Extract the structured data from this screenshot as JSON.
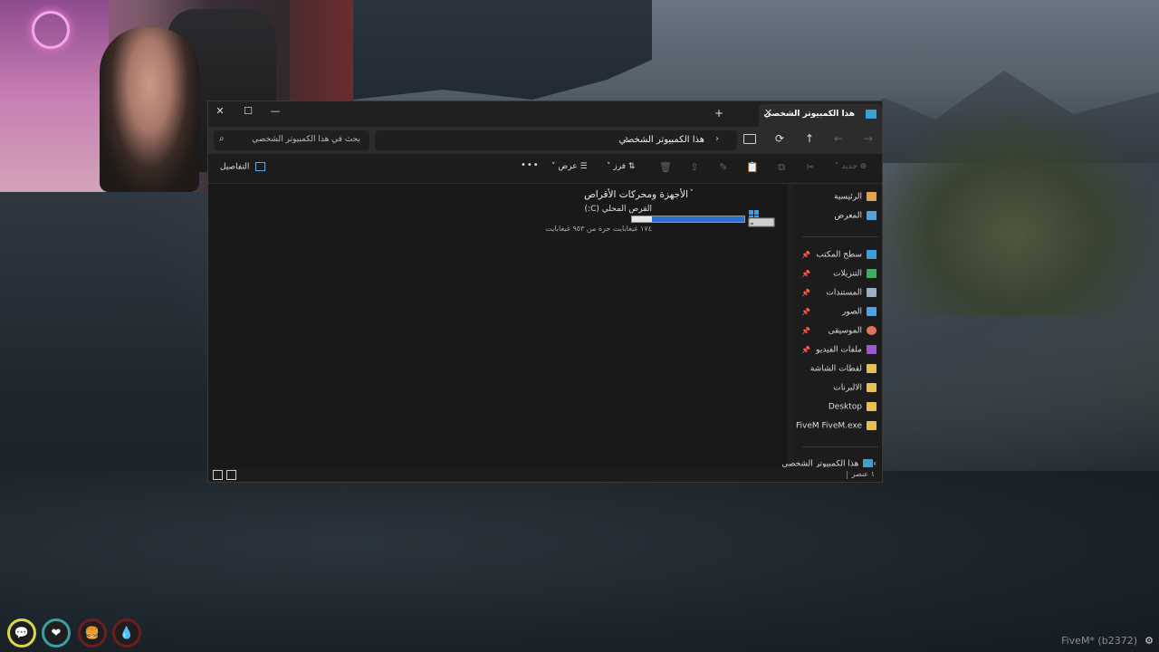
{
  "window": {
    "tab_title": "هذا الكمبيوتر الشخصي",
    "new_tab": "+",
    "tab_close": "✕",
    "minimize": "—",
    "maximize": "☐",
    "close": "✕"
  },
  "addressbar": {
    "path": "هذا الكمبيوتر الشخصي",
    "search_placeholder": "بحث في هذا الكمبيوتر الشخصي",
    "chev": "›",
    "chev2": "›"
  },
  "nav_buttons": {
    "back": "←",
    "forward": "→",
    "up": "↑",
    "refresh": "⟳"
  },
  "toolbar": {
    "new_label": "جديد",
    "sort_label": "فرز",
    "view_label": "عرض",
    "more_label": "•••",
    "details_label": "التفاصيل"
  },
  "content": {
    "group_header": "الأجهزة ومحركات الأقراص",
    "drive_label": "القرص المحلي (C:)",
    "drive_free": "١٧٤ غيغابايت حرة من ٩٥٣ غيغابايت",
    "drive_used_fraction": 0.82
  },
  "nav_pane": {
    "home": "الرئيسية",
    "gallery": "المعرض",
    "desktop": "سطح المكتب",
    "downloads": "التنزيلات",
    "documents": "المستندات",
    "pictures": "الصور",
    "music": "الموسيقى",
    "videos": "ملفات الفيديو",
    "screenshots": "لقطات الشاشة",
    "albums": "الالبرنات",
    "desktop_en": "Desktop",
    "fivem": "FiveM FiveM.exe",
    "this_pc": "هذا الكمبيوتر الشخصي"
  },
  "status": {
    "items": "١ عنصر"
  },
  "game": {
    "fivem": "FiveM* (b2372)"
  }
}
